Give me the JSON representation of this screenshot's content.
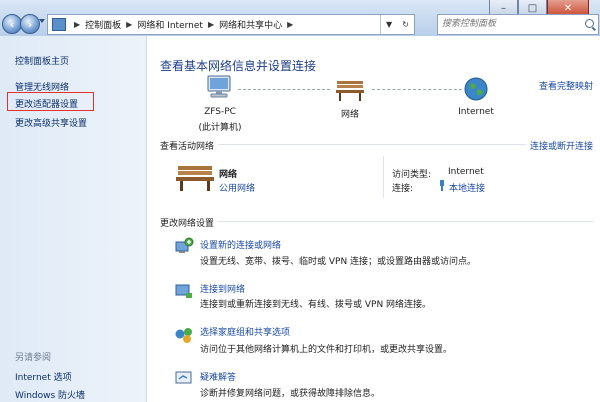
{
  "window_controls": {
    "minimize": "–",
    "maximize": "□",
    "close": "✕"
  },
  "address": {
    "segments": [
      "控制面板",
      "网络和 Internet",
      "网络和共享中心"
    ]
  },
  "search": {
    "placeholder": "搜索控制面板"
  },
  "sidebar": {
    "items": [
      {
        "label": "控制面板主页"
      },
      {
        "label": "管理无线网络"
      },
      {
        "label": "更改适配器设置"
      },
      {
        "label": "更改高级共享设置"
      }
    ],
    "see_also_title": "另请参阅",
    "see_also": [
      {
        "label": "Internet 选项"
      },
      {
        "label": "Windows 防火墙"
      }
    ]
  },
  "main": {
    "title": "查看基本网络信息并设置连接",
    "view_full_map": "查看完整映射",
    "map": {
      "computer_name": "ZFS-PC",
      "computer_sub": "(此计算机)",
      "network": "网络",
      "internet": "Internet"
    },
    "active": {
      "heading": "查看活动网络",
      "connect_link": "连接或断开连接",
      "network_name": "网络",
      "network_type": "公用网络",
      "access_type_label": "访问类型:",
      "access_type_value": "Internet",
      "connections_label": "连接:",
      "connections_value": "本地连接"
    },
    "change": {
      "heading": "更改网络设置",
      "items": [
        {
          "link": "设置新的连接或网络",
          "desc": "设置无线、宽带、拨号、临时或 VPN 连接；或设置路由器或访问点。"
        },
        {
          "link": "连接到网络",
          "desc": "连接到或重新连接到无线、有线、拨号或 VPN 网络连接。"
        },
        {
          "link": "选择家庭组和共享选项",
          "desc": "访问位于其他网络计算机上的文件和打印机，或更改共享设置。"
        },
        {
          "link": "疑难解答",
          "desc": "诊断并修复网络问题，或获得故障排除信息。"
        }
      ]
    }
  }
}
